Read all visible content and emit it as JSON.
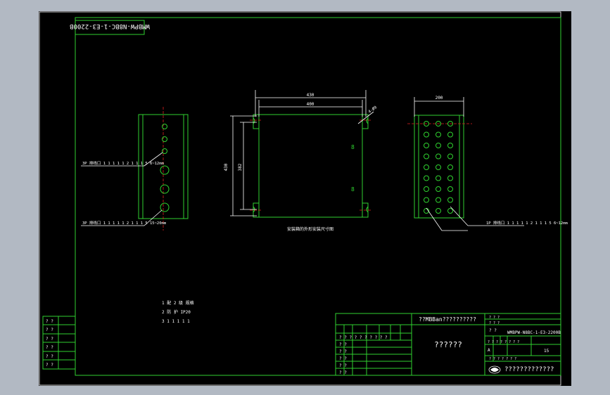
{
  "title_block": {
    "corner_code": "WMBPW-N8BC-1-E3-2200B",
    "row1": "??MBBan??????????",
    "center_label": "??????",
    "drawing_number": "WMBPW-N8BC-1-E3-2200B",
    "company": "?????????????",
    "scale_col": "15",
    "grid_marks": [
      "?",
      "?",
      "?",
      "?",
      "?",
      "?",
      "?",
      "?",
      "?"
    ]
  },
  "dimensions": {
    "width_outer": "430",
    "width_inner": "400",
    "height_outer": "430",
    "height_inner": "382",
    "side_width": "200",
    "mount_hole": "4-Ø9"
  },
  "annotations": {
    "left_top": "3P 排线口 1 1 1 1 1 2 1 1 1 5  6~12mm",
    "left_bottom": "3P 排线口 1 1 1 1 1 2 1 1 1 5  15~20mm",
    "right_callout": "1P 排线口 1 1 1 1 1 2 1 1 1 5  6~12mm",
    "front_caption": "安装箱的外形安装尺寸图"
  },
  "notes": {
    "line1": "1    配 2 级 规格",
    "line2": "2    防 护 IP20",
    "line3": "3    1 1 1 1 1"
  },
  "colors": {
    "background": "#b2b9c3",
    "sheet": "#000000",
    "lines": "#2fd12f",
    "text": "#ffffff",
    "centerline": "#e02020"
  }
}
